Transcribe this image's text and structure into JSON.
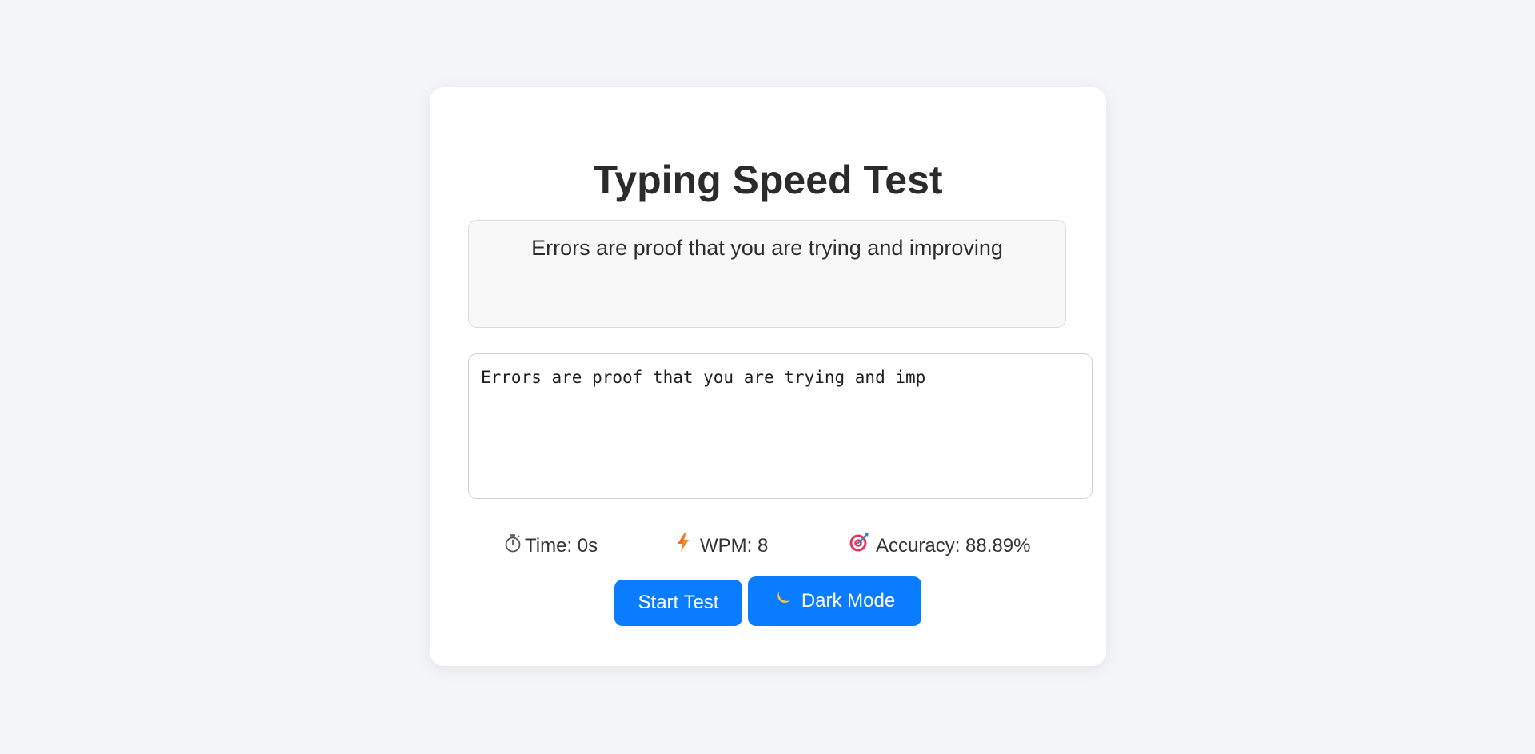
{
  "app": {
    "title": "Typing Speed Test"
  },
  "quote": {
    "text": "Errors are proof that you are trying and improving"
  },
  "input": {
    "value": "Errors are proof that you are trying and imp"
  },
  "stats": {
    "time": {
      "icon": "stopwatch-icon",
      "label": "Time: 0s"
    },
    "wpm": {
      "icon": "lightning-icon",
      "label": "WPM: 8"
    },
    "accuracy": {
      "icon": "target-icon",
      "label": "Accuracy: 88.89%"
    }
  },
  "buttons": {
    "start": {
      "label": "Start Test"
    },
    "dark_mode": {
      "icon": "moon-icon",
      "label": "Dark Mode"
    }
  },
  "colors": {
    "accent": "#0a7cff",
    "background": "#f4f5f9",
    "card": "#ffffff"
  }
}
